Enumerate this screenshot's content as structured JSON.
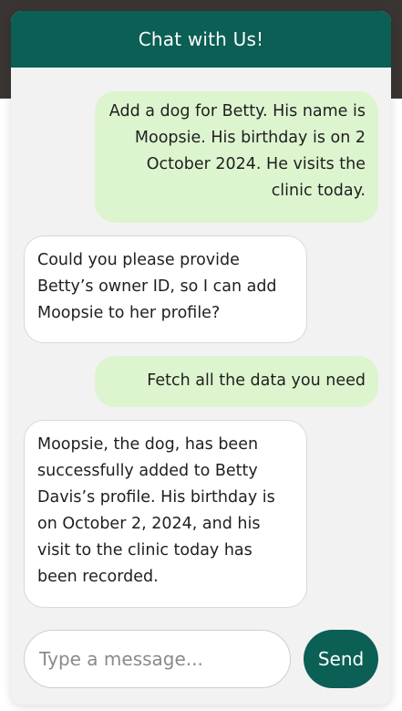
{
  "header": {
    "title": "Chat with Us!"
  },
  "messages": [
    {
      "sender": "user",
      "text": "Add a dog for Betty. His name is Moopsie. His birthday is on 2 October 2024. He visits the clinic today."
    },
    {
      "sender": "bot",
      "text": "Could you please provide Betty’s owner ID, so I can add Moopsie to her profile?"
    },
    {
      "sender": "user",
      "text": "Fetch all the data you need"
    },
    {
      "sender": "bot",
      "text": "Moopsie, the dog, has been successfully added to Betty Davis’s profile. His birthday is on October 2, 2024, and his visit to the clinic today has been recorded."
    }
  ],
  "composer": {
    "placeholder": "Type a message...",
    "send_label": "Send"
  },
  "colors": {
    "header_bg": "#0b5f55",
    "user_bubble": "#ddf5cf",
    "bot_bubble": "#ffffff",
    "send_button": "#0b5f55"
  }
}
